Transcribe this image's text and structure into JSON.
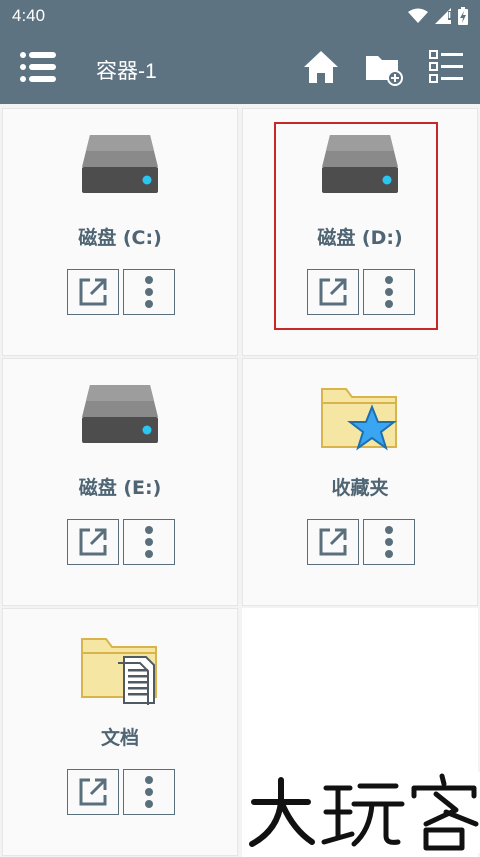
{
  "status": {
    "time": "4:40"
  },
  "appbar": {
    "title": "容器-1"
  },
  "items": [
    {
      "label": "磁盘 (C:)",
      "icon": "drive-icon"
    },
    {
      "label": "磁盘 (D:)",
      "icon": "drive-icon"
    },
    {
      "label": "磁盘 (E:)",
      "icon": "drive-icon"
    },
    {
      "label": "收藏夹",
      "icon": "favorites-folder-icon"
    },
    {
      "label": "文档",
      "icon": "documents-folder-icon"
    }
  ],
  "watermark": {
    "text": "大玩客"
  },
  "colors": {
    "appbar": "#5d7381",
    "label": "#4f6574",
    "highlight": "#c62828",
    "drive_led": "#29c6f0",
    "folder": "#f6e6a3"
  }
}
